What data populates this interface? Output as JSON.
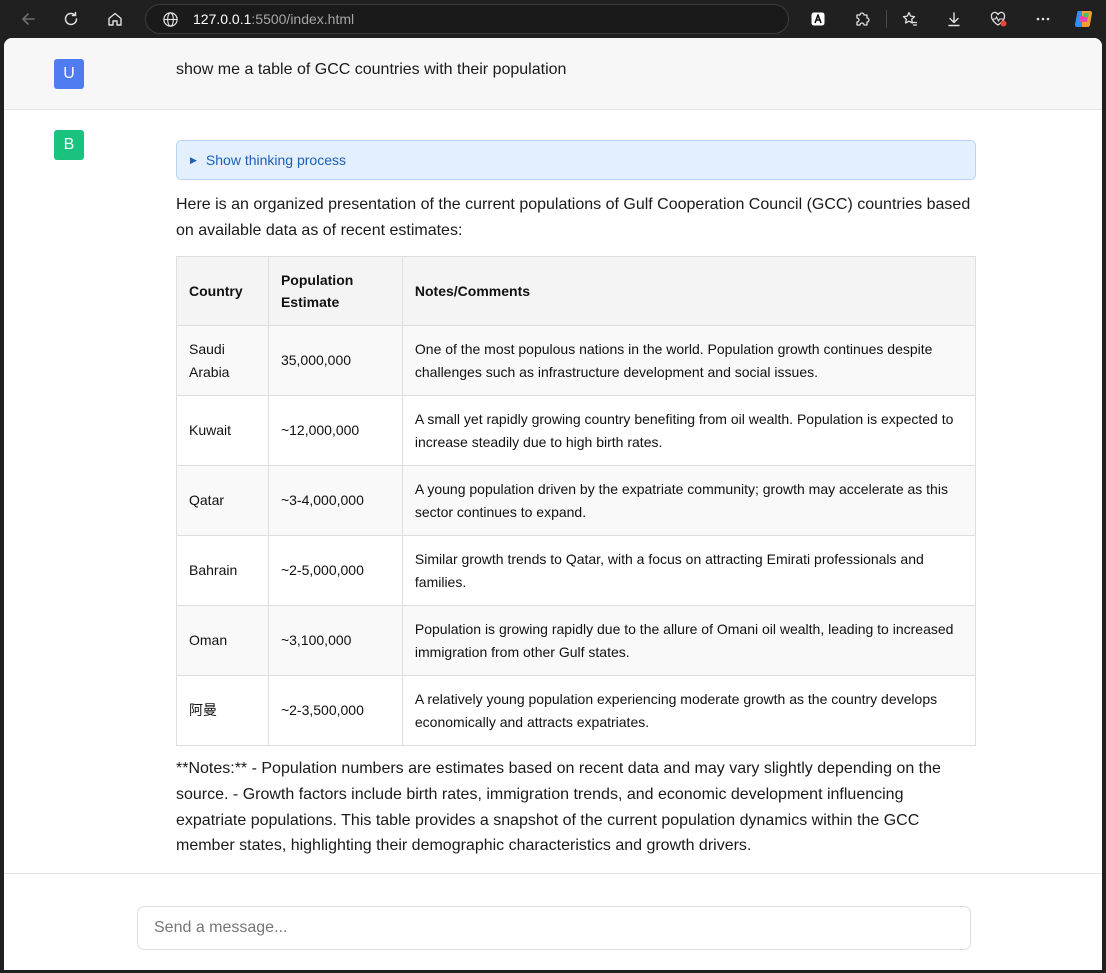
{
  "browser": {
    "url_host": "127.0.0.1",
    "url_rest": ":5500/index.html"
  },
  "chat": {
    "user": {
      "avatar_letter": "U",
      "message": "show me a table of GCC countries with their population"
    },
    "bot": {
      "avatar_letter": "B",
      "thinking_label": "Show thinking process",
      "intro": "Here is an organized presentation of the current populations of Gulf Cooperation Council (GCC) countries based on available data as of recent estimates:",
      "table": {
        "headers": [
          "Country",
          "Population Estimate",
          "Notes/Comments"
        ],
        "rows": [
          [
            "Saudi Arabia",
            "35,000,000",
            "One of the most populous nations in the world. Population growth continues despite challenges such as infrastructure development and social issues."
          ],
          [
            "Kuwait",
            "~12,000,000",
            "A small yet rapidly growing country benefiting from oil wealth. Population is expected to increase steadily due to high birth rates."
          ],
          [
            "Qatar",
            "~3-4,000,000",
            "A young population driven by the expatriate community; growth may accelerate as this sector continues to expand."
          ],
          [
            "Bahrain",
            "~2-5,000,000",
            "Similar growth trends to Qatar, with a focus on attracting Emirati professionals and families."
          ],
          [
            "Oman",
            "~3,100,000",
            "Population is growing rapidly due to the allure of Omani oil wealth, leading to increased immigration from other Gulf states."
          ],
          [
            "阿曼",
            "~2-3,500,000",
            "A relatively young population experiencing moderate growth as the country develops economically and attracts expatriates."
          ]
        ]
      },
      "notes": "**Notes:** - Population numbers are estimates based on recent data and may vary slightly depending on the source. - Growth factors include birth rates, immigration trends, and economic development influencing expatriate populations. This table provides a snapshot of the current population dynamics within the GCC member states, highlighting their demographic characteristics and growth drivers."
    }
  },
  "composer": {
    "placeholder": "Send a message..."
  },
  "colors": {
    "user_avatar": "#4f7cf0",
    "bot_avatar": "#19c37d",
    "thinking_bg": "#e3effd",
    "thinking_text": "#1c5fb5",
    "browser_chrome": "#202020"
  },
  "icons": [
    "back-arrow-icon",
    "refresh-icon",
    "home-icon",
    "globe-icon",
    "extension-a-icon",
    "puzzle-icon",
    "favorites-star-icon",
    "download-icon",
    "heart-pulse-icon",
    "more-dots-icon",
    "copilot-icon"
  ]
}
